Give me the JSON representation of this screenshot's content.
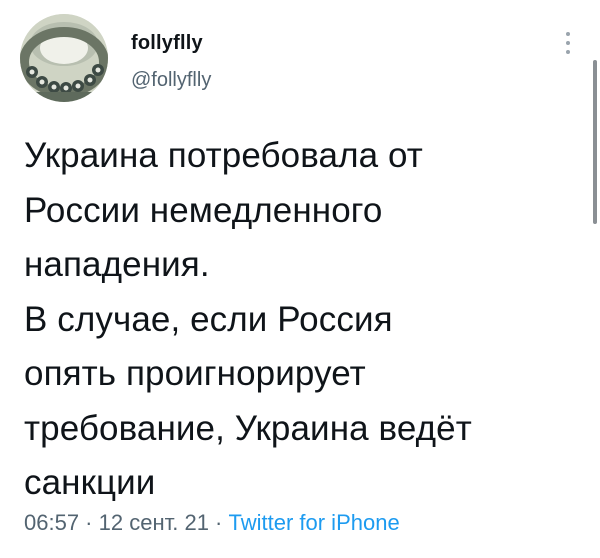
{
  "tweet": {
    "author": {
      "display_name": "follyflly",
      "handle": "@follyflly",
      "avatar_icon": "avatar-image"
    },
    "more_icon": "more-vertical-icon",
    "text_lines": [
      "Украина потребовала от",
      "России немедленного",
      "нападения.",
      "В случае, если Россия",
      "опять проигнорирует",
      "требование, Украина ведёт",
      "санкции"
    ],
    "time": "06:57",
    "separator": " · ",
    "date": "12 сент. 21",
    "source": "Twitter for iPhone",
    "colors": {
      "text": "#0f1419",
      "secondary": "#536471",
      "link": "#1d9bf0"
    }
  }
}
